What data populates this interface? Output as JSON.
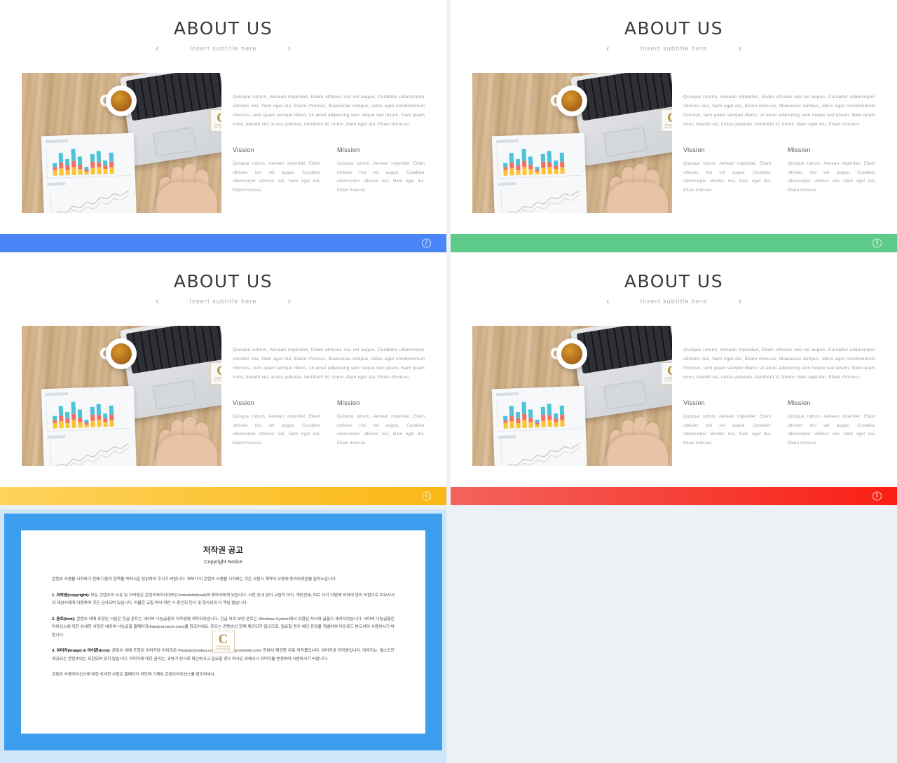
{
  "page": {
    "background_color": "#edf0f4",
    "layout": "slide-thumbnail-grid"
  },
  "slide_common": {
    "title": "ABOUT US",
    "subtitle": "Insert subtitle here",
    "prev_arrow": "‹",
    "next_arrow": "›",
    "lead_paragraph": "Quisque rutrum, Aenean imperdiet, Etiam ultricies nisi vel augue, Curabitur ullamcorper ultricies nisi, Nam eget dui, Etiam rhoncus, Maecenas tempus, tellus eget condimentum rhoncus, sem quam semper libero, sit amet adipiscing sem neque sed ipsum, Nam quam nunc, blandit vel, luctus pulvinar, hendrerit id, lorem, Nam eget dui, Etiam rhoncus.",
    "columns": [
      {
        "heading": "Vission",
        "text": "Quisque rutrum, Aenean imperdiet, Etiam ultricies nisi vel augue, Curabitur ullamcorper ultricies nisi, Nam eget dui, Etiam rhoncus."
      },
      {
        "heading": "Mission",
        "text": "Quisque rutrum, Aenean imperdiet, Etiam ultricies nisi vel augue, Curabitur ullamcorper ultricies nisi, Nam eget dui, Etiam rhoncus."
      }
    ],
    "watermark": {
      "letter": "C",
      "line1": "CONCEPTS",
      "line2": "PPT  TEMPLATE"
    }
  },
  "slides": [
    {
      "id": "slide-blue",
      "page_number": "2",
      "accent_color": "#4a86f7",
      "bar_gradient": "linear-gradient(90deg,#4a86f7,#4a86f7)"
    },
    {
      "id": "slide-green",
      "page_number": "3",
      "accent_color": "#5ecb8b",
      "bar_gradient": "linear-gradient(90deg,#5ecb8b,#5ecb8b)"
    },
    {
      "id": "slide-yellow",
      "page_number": "4",
      "accent_color": "#fbc42e",
      "bar_gradient": "linear-gradient(90deg,#fdd35b,#fbb715)"
    },
    {
      "id": "slide-red",
      "page_number": "5",
      "accent_color": "#f5403a",
      "bar_gradient": "linear-gradient(90deg,#f2635c,#fa1f14)"
    }
  ],
  "copyright_slide": {
    "frame_color": "#3d9ef0",
    "outer_color": "#cfe6fa",
    "title_ko": "저작권 공고",
    "title_en": "Copyright Notice",
    "intro": "콘텐츠 사용을 시작하기 전에 다음의 항목을 꼭하시길 정읽하여 주시기 바랍니다. 귀하가 이 콘텐츠 사용을 시작하는 것은 사용시 계약의 보증에 동의하셨음을 알리노답니다.",
    "sections": [
      {
        "label": "1. 저작권(copyright):",
        "text": " 모든 콘텐츠의 소유 및 저작권은 콘텐츠하이다어옷(Contentshideout)에 제작사에게 있습니다. 사전 승냬 없이 교립적 이익, 개단전세, 비로 사각 다법에 의하여 연리 포함으로 이보사서의 제삼사에게 이용하여 것은 금사되여 있습니다. 이를한 교립 여사 위반 시 중인되 민사 및 형사상의 사 책임 발습니다."
      },
      {
        "label": "2. 폰트(font):",
        "text": " 콘텐츠 내에 포함된 서임은 한글 폰트는 네이버 나눔글꼴의 저작권에 제작되었습니다. 한글 외의 보면 폰트는 Windows System에서 보합된 사서와 글꼴으 제작되었습니다. 네이버 나눔글꼴은 라이선스에 대한 상세한 사항은 네이버 나눔글꼴 홈페이지(hangeul.naver.com)를 참조하세요. 폰트는 콘텐츠의 함께 제공되지 않으므로, 필요할 경우 해당 폰트를 개별하여 다운로드 받으셔야 사용하시기 바랍니다."
      },
      {
        "label": "3. 이미지(image) & 아이콘(icon):",
        "text": " 콘텐츠 내에 포함된 이미지와 아이콘은 Pixabay(pixabay.com) 및 Weboily(weboily.com) 등에서 제공한 무료 저작물입니다. 이미지와 저작권입니다. 이미지는, 별소도만 제공되는 콘텐츠의는 포함되어 있지 않습니다. 이미지에 대한 권리는, 귀하가 상사로 확인하시고 필요할 경우 여사문 위해서나 이미지를 변경하여 사용하시기 바랍니다."
      }
    ],
    "closing": "콘텐츠 사용라이선스에 대한 상세한 사항은 홈페이지 하단에 기재된 콘텐츠라이선스를 참조하세요."
  }
}
